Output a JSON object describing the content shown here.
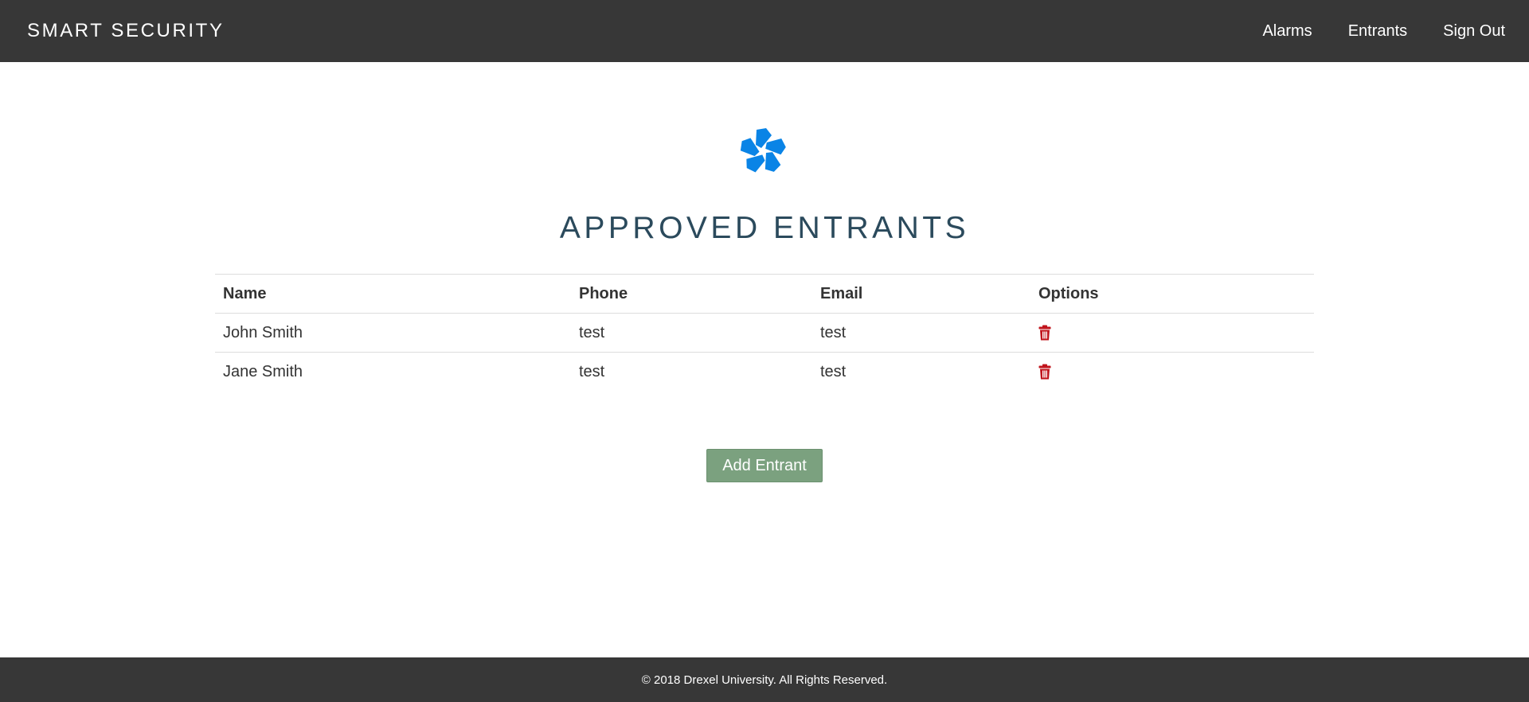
{
  "navbar": {
    "brand": "SMART SECURITY",
    "links": [
      {
        "label": "Alarms"
      },
      {
        "label": "Entrants"
      },
      {
        "label": "Sign Out"
      }
    ]
  },
  "logo": {
    "icon": "flower-logo-icon",
    "color": "#0a84e6"
  },
  "main": {
    "title": "APPROVED ENTRANTS",
    "table": {
      "columns": [
        "Name",
        "Phone",
        "Email",
        "Options"
      ],
      "rows": [
        {
          "name": "John Smith",
          "phone": "test",
          "email": "test",
          "option_icon": "trash-icon"
        },
        {
          "name": "Jane Smith",
          "phone": "test",
          "email": "test",
          "option_icon": "trash-icon"
        }
      ]
    },
    "add_button_label": "Add Entrant"
  },
  "footer": {
    "text": "© 2018 Drexel University. All Rights Reserved."
  },
  "colors": {
    "navbar_bg": "#373737",
    "title": "#2b4a5c",
    "add_button": "#7ba17f",
    "trash_icon": "#c0141c",
    "logo": "#0a84e6"
  }
}
